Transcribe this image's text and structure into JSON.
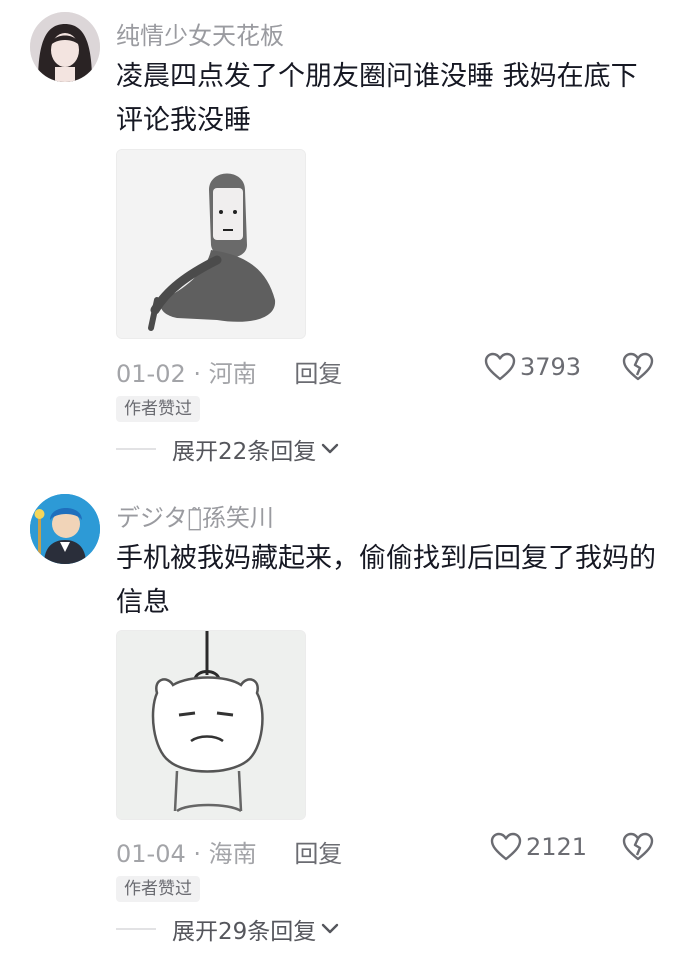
{
  "comments": [
    {
      "username": "纯情少女天花板",
      "text": "凌晨四点发了个朋友圈问谁没睡 我妈在底下评论我没睡",
      "date": "01-02",
      "separator": "·",
      "location": "河南",
      "reply_label": "回复",
      "likes": "3793",
      "badge": "作者赞过",
      "expand_label": "展开22条回复"
    },
    {
      "username": "デジタル̃孫笑川",
      "text": "手机被我妈藏起来，偷偷找到后回复了我妈的信息",
      "date": "01-04",
      "separator": "·",
      "location": "海南",
      "reply_label": "回复",
      "likes": "2121",
      "badge": "作者赞过",
      "expand_label": "展开29条回复"
    }
  ],
  "icons": {
    "like": "heart-icon",
    "dislike": "broken-heart-icon",
    "expand": "chevron-down-icon"
  },
  "colors": {
    "username": "#9a9ba0",
    "text": "#161823",
    "meta": "#a3a4a8"
  }
}
